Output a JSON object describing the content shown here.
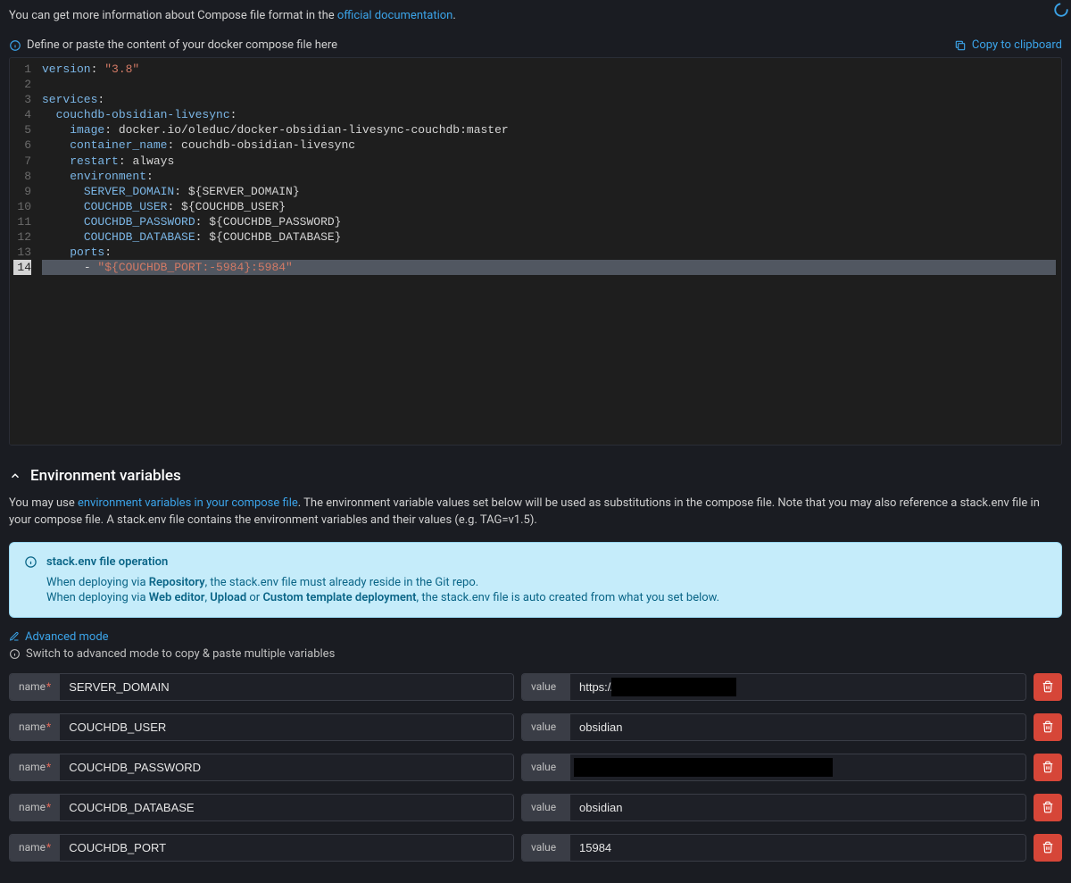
{
  "intro": {
    "prefix": "You can get more information about Compose file format in the ",
    "link": "official documentation",
    "suffix": "."
  },
  "editor": {
    "hint": "Define or paste the content of your docker compose file here",
    "copy_label": "Copy to clipboard",
    "lines": [
      {
        "n": 1,
        "tokens": [
          {
            "c": "key",
            "t": "version"
          },
          {
            "c": "punct",
            "t": ": "
          },
          {
            "c": "str",
            "t": "\"3.8\""
          }
        ]
      },
      {
        "n": 2,
        "tokens": []
      },
      {
        "n": 3,
        "tokens": [
          {
            "c": "key",
            "t": "services"
          },
          {
            "c": "punct",
            "t": ":"
          }
        ]
      },
      {
        "n": 4,
        "indent": "  ",
        "tokens": [
          {
            "c": "key",
            "t": "couchdb-obsidian-livesync"
          },
          {
            "c": "punct",
            "t": ":"
          }
        ]
      },
      {
        "n": 5,
        "indent": "    ",
        "tokens": [
          {
            "c": "key",
            "t": "image"
          },
          {
            "c": "punct",
            "t": ": "
          },
          {
            "c": "plain",
            "t": "docker.io/oleduc/docker-obsidian-livesync-couchdb:master"
          }
        ]
      },
      {
        "n": 6,
        "indent": "    ",
        "tokens": [
          {
            "c": "key",
            "t": "container_name"
          },
          {
            "c": "punct",
            "t": ": "
          },
          {
            "c": "plain",
            "t": "couchdb-obsidian-livesync"
          }
        ]
      },
      {
        "n": 7,
        "indent": "    ",
        "tokens": [
          {
            "c": "key",
            "t": "restart"
          },
          {
            "c": "punct",
            "t": ": "
          },
          {
            "c": "plain",
            "t": "always"
          }
        ]
      },
      {
        "n": 8,
        "indent": "    ",
        "tokens": [
          {
            "c": "key",
            "t": "environment"
          },
          {
            "c": "punct",
            "t": ":"
          }
        ]
      },
      {
        "n": 9,
        "indent": "      ",
        "tokens": [
          {
            "c": "key",
            "t": "SERVER_DOMAIN"
          },
          {
            "c": "punct",
            "t": ": "
          },
          {
            "c": "plain",
            "t": "${SERVER_DOMAIN}"
          }
        ]
      },
      {
        "n": 10,
        "indent": "      ",
        "tokens": [
          {
            "c": "key",
            "t": "COUCHDB_USER"
          },
          {
            "c": "punct",
            "t": ": "
          },
          {
            "c": "plain",
            "t": "${COUCHDB_USER}"
          }
        ]
      },
      {
        "n": 11,
        "indent": "      ",
        "tokens": [
          {
            "c": "key",
            "t": "COUCHDB_PASSWORD"
          },
          {
            "c": "punct",
            "t": ": "
          },
          {
            "c": "plain",
            "t": "${COUCHDB_PASSWORD}"
          }
        ]
      },
      {
        "n": 12,
        "indent": "      ",
        "tokens": [
          {
            "c": "key",
            "t": "COUCHDB_DATABASE"
          },
          {
            "c": "punct",
            "t": ": "
          },
          {
            "c": "plain",
            "t": "${COUCHDB_DATABASE}"
          }
        ]
      },
      {
        "n": 13,
        "indent": "    ",
        "tokens": [
          {
            "c": "key",
            "t": "ports"
          },
          {
            "c": "punct",
            "t": ":"
          }
        ]
      },
      {
        "n": 14,
        "active": true,
        "indent": "      ",
        "tokens": [
          {
            "c": "punct",
            "t": "- "
          },
          {
            "c": "str",
            "t": "\"${COUCHDB_PORT:-5984}:5984\""
          }
        ]
      }
    ]
  },
  "env_section": {
    "title": "Environment variables",
    "desc_prefix": "You may use ",
    "desc_link": "environment variables in your compose file",
    "desc_suffix": ". The environment variable values set below will be used as substitutions in the compose file. Note that you may also reference a stack.env file in your compose file. A stack.env file contains the environment variables and their values (e.g. TAG=v1.5)."
  },
  "info_box": {
    "title": "stack.env file operation",
    "line1_pre": "When deploying via ",
    "line1_bold": "Repository",
    "line1_post": ", the stack.env file must already reside in the Git repo.",
    "line2_pre": "When deploying via ",
    "line2_b1": "Web editor",
    "line2_sep1": ", ",
    "line2_b2": "Upload",
    "line2_sep2": " or ",
    "line2_b3": "Custom template deployment",
    "line2_post": ", the stack.env file is auto created from what you set below."
  },
  "advanced": {
    "link": "Advanced mode",
    "hint": "Switch to advanced mode to copy & paste multiple variables"
  },
  "labels": {
    "name": "name",
    "value": "value"
  },
  "env_vars": [
    {
      "name": "SERVER_DOMAIN",
      "value": "https://",
      "redacted": true
    },
    {
      "name": "COUCHDB_USER",
      "value": "obsidian",
      "redacted": false
    },
    {
      "name": "COUCHDB_PASSWORD",
      "value": "",
      "redacted": true,
      "full_redact": true
    },
    {
      "name": "COUCHDB_DATABASE",
      "value": "obsidian",
      "redacted": false
    },
    {
      "name": "COUCHDB_PORT",
      "value": "15984",
      "redacted": false
    }
  ]
}
